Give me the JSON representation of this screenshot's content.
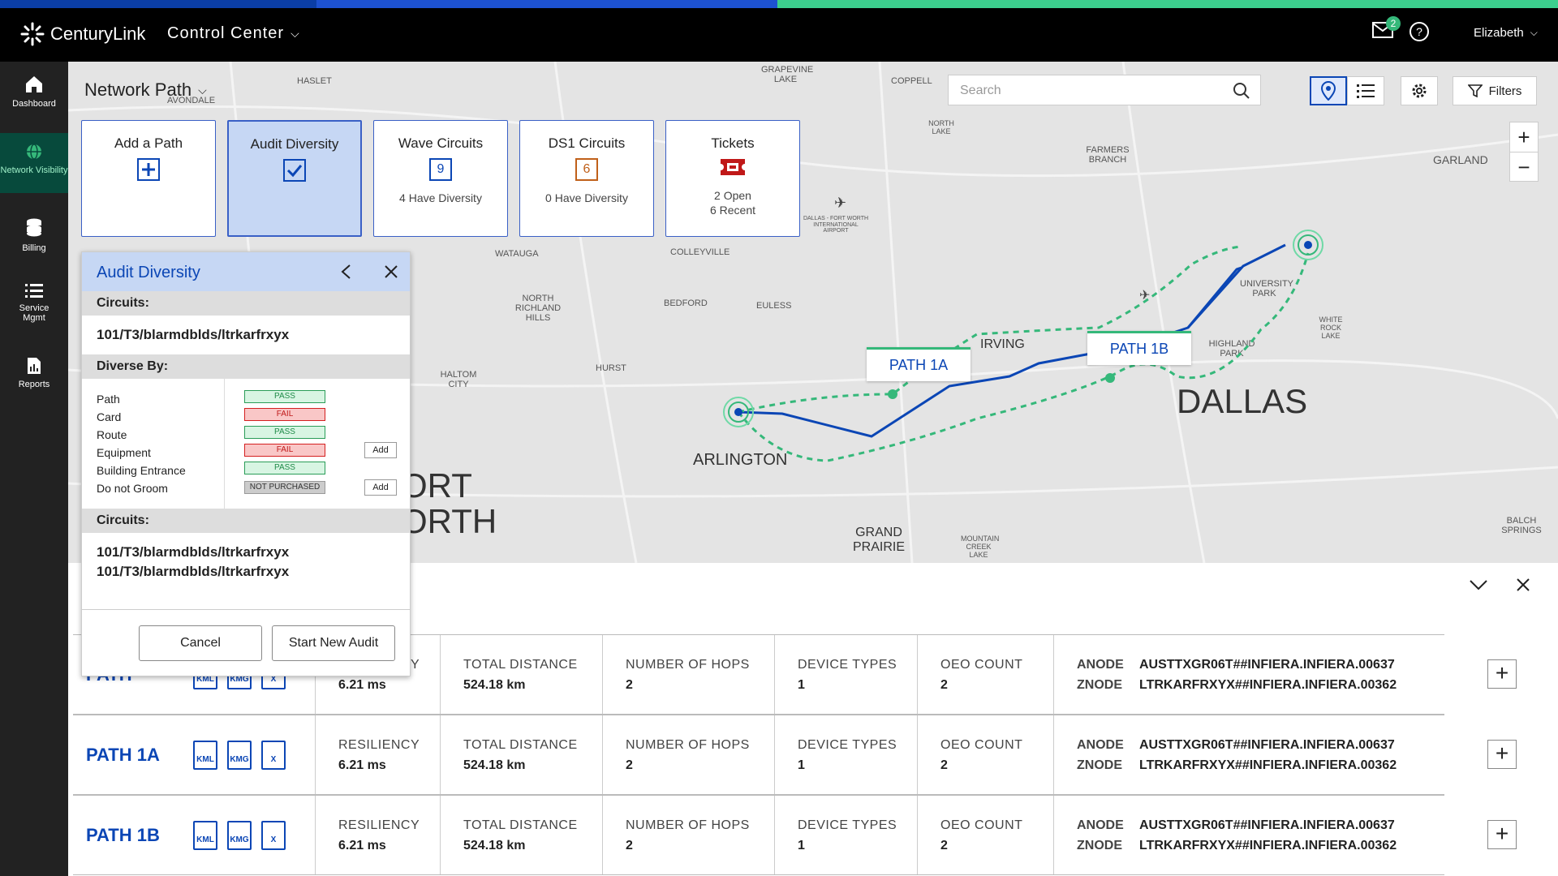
{
  "header": {
    "brand": "CenturyLink",
    "app": "Control Center",
    "notifications": "2",
    "user": "Elizabeth"
  },
  "sidebar": {
    "items": [
      {
        "label": "Dashboard",
        "icon": "home-icon"
      },
      {
        "label": "Network Visibility",
        "icon": "globe-icon"
      },
      {
        "label": "Billing",
        "icon": "coins-icon"
      },
      {
        "label": "Service Mgmt",
        "icon": "list-icon"
      },
      {
        "label": "Reports",
        "icon": "report-icon"
      }
    ]
  },
  "map": {
    "title": "Network Path",
    "search_placeholder": "Search",
    "filters_label": "Filters",
    "labels": {
      "haslet": "HASLET",
      "coppell": "COPPELL",
      "grapevine": "GRAPEVINE LAKE",
      "north_lake": "NORTH LAKE",
      "farmers": "FARMERS BRANCH",
      "garland": "GARLAND",
      "watauga": "WATAUGA",
      "colleyville": "COLLEYVILLE",
      "bedford": "BEDFORD",
      "euless": "EULESS",
      "nrh": "NORTH RICHLAND HILLS",
      "hurst": "HURST",
      "haltom": "HALTOM CITY",
      "irving": "IRVING",
      "dallas": "DALLAS",
      "arlington": "ARLINGTON",
      "grand_prairie": "GRAND PRAIRIE",
      "fort": "ORT",
      "worth": "ORTH",
      "univ_park": "UNIVERSITY PARK",
      "highland": "HIGHLAND PARK",
      "white_rock": "WHITE ROCK LAKE",
      "balch": "BALCH SPRINGS",
      "dfw": "DALLAS - FORT WORTH INTERNATIONAL AIRPORT",
      "mountain_creek": "MOUNTAIN CREEK LAKE",
      "avondale": "AVONDALE"
    },
    "callouts": {
      "a": "PATH 1A",
      "b": "PATH 1B"
    }
  },
  "tiles": [
    {
      "title": "Add a Path",
      "icon": "plus-box-icon"
    },
    {
      "title": "Audit Diversity",
      "icon": "checkbox-icon"
    },
    {
      "title": "Wave Circuits",
      "num": "9",
      "sub": "4 Have Diversity"
    },
    {
      "title": "DS1 Circuits",
      "num": "6",
      "sub": "0 Have Diversity"
    },
    {
      "title": "Tickets",
      "icon": "ticket-icon",
      "sub1": "2 Open",
      "sub2": "6 Recent"
    }
  ],
  "audit": {
    "title": "Audit Diversity",
    "circuits_label": "Circuits:",
    "circuit": "101/T3/blarmdblds/ltrkarfrxyx",
    "diverse_label": "Diverse By:",
    "checks": [
      {
        "name": "Path",
        "status": "PASS"
      },
      {
        "name": "Card",
        "status": "FAIL"
      },
      {
        "name": "Route",
        "status": "PASS"
      },
      {
        "name": "Equipment",
        "status": "FAIL",
        "action": "Add"
      },
      {
        "name": "Building Entrance",
        "status": "PASS"
      },
      {
        "name": "Do not Groom",
        "status": "NOT PURCHASED",
        "action": "Add"
      }
    ],
    "circuits2_label": "Circuits:",
    "circuits2": [
      "101/T3/blarmdblds/ltrkarfrxyx",
      "101/T3/blarmdblds/ltrkarfrxyx"
    ],
    "cancel": "Cancel",
    "start": "Start New Audit"
  },
  "table": {
    "rows": [
      {
        "path": "PATH",
        "resiliency_label": "RESILIENCY",
        "resiliency": "6.21 ms",
        "distance_label": "TOTAL DISTANCE",
        "distance": "524.18 km",
        "hops_label": "NUMBER OF HOPS",
        "hops": "2",
        "device_label": "DEVICE TYPES",
        "device": "1",
        "oeo_label": "OEO COUNT",
        "oeo": "2",
        "anode_label": "ANODE",
        "anode": "AUSTTXGR06T##INFIERA.INFIERA.00637",
        "znode_label": "ZNODE",
        "znode": "LTRKARFRXYX##INFIERA.INFIERA.00362"
      },
      {
        "path": "PATH 1A",
        "resiliency_label": "RESILIENCY",
        "resiliency": "6.21 ms",
        "distance_label": "TOTAL DISTANCE",
        "distance": "524.18 km",
        "hops_label": "NUMBER OF HOPS",
        "hops": "2",
        "device_label": "DEVICE TYPES",
        "device": "1",
        "oeo_label": "OEO COUNT",
        "oeo": "2",
        "anode_label": "ANODE",
        "anode": "AUSTTXGR06T##INFIERA.INFIERA.00637",
        "znode_label": "ZNODE",
        "znode": "LTRKARFRXYX##INFIERA.INFIERA.00362"
      },
      {
        "path": "PATH 1B",
        "resiliency_label": "RESILIENCY",
        "resiliency": "6.21 ms",
        "distance_label": "TOTAL DISTANCE",
        "distance": "524.18 km",
        "hops_label": "NUMBER OF HOPS",
        "hops": "2",
        "device_label": "DEVICE TYPES",
        "device": "1",
        "oeo_label": "OEO COUNT",
        "oeo": "2",
        "anode_label": "ANODE",
        "anode": "AUSTTXGR06T##INFIERA.INFIERA.00637",
        "znode_label": "ZNODE",
        "znode": "LTRKARFRXYX##INFIERA.INFIERA.00362"
      }
    ],
    "files": [
      "KML",
      "KMG",
      "X"
    ]
  },
  "colors": {
    "brand_blue": "#0b46b5",
    "accent_green": "#35b87a",
    "stripe_blue": "#0b3ea6"
  }
}
